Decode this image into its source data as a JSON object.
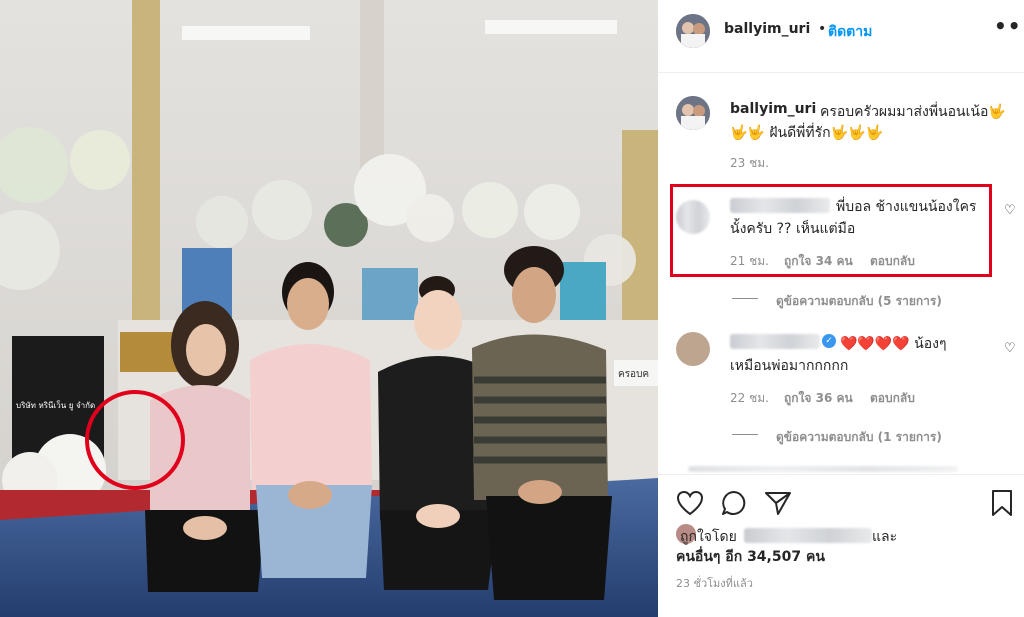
{
  "post": {
    "username": "ballyim_uri",
    "follow_separator": "•",
    "follow_label": "ติดตาม",
    "more_icon": "more-horizontal-icon"
  },
  "caption": {
    "username": "ballyim_uri",
    "line1": "ครอบครัวผมมาส่งพี่นอนเน้อ🤟",
    "line2": "🤟🤟 ฝันดีพี่ที่รัก🤟🤟🤟",
    "time": "23 ชม."
  },
  "comments": [
    {
      "line1": "พี่บอล ช้างแขนน้องใคร",
      "line2": "นั้งครับ ?? เห็นแต่มือ",
      "time": "21 ชม.",
      "likes": "ถูกใจ 34 คน",
      "reply": "ตอบกลับ",
      "view_replies": "ดูข้อความตอบกลับ (5 รายการ)",
      "highlight_color": "#e0001b"
    },
    {
      "line1": "❤️❤️❤️❤️ น้องๆ",
      "line2": "เหมือนพ่อมากกกกก",
      "time": "22 ชม.",
      "likes": "ถูกใจ 36 คน",
      "reply": "ตอบกลับ",
      "view_replies": "ดูข้อความตอบกลับ (1 รายการ)"
    }
  ],
  "actions": {
    "like_icon": "heart-icon",
    "comment_icon": "comment-icon",
    "share_icon": "share-icon",
    "save_icon": "bookmark-icon"
  },
  "likes": {
    "prefix": "ถูกใจโดย",
    "conj": "และ",
    "rest": "คนอื่นๆ อีก 34,507 คน"
  },
  "timestamp": "23 ชั่วโมงที่แล้ว",
  "photo": {
    "sign_left": "บริษัท หรินีเว็น ยู จำกัด",
    "sign_right": "ครอบค",
    "annotation_color": "#e0001b"
  }
}
